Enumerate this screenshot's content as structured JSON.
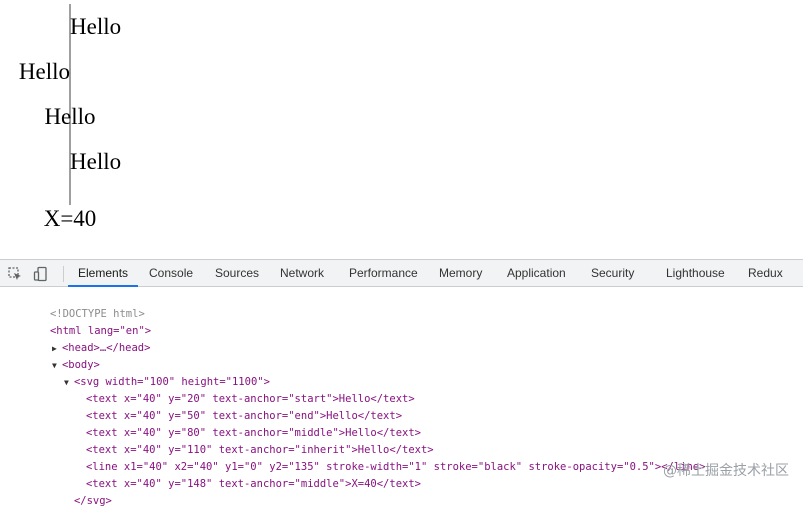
{
  "rendered": {
    "texts": [
      "Hello",
      "Hello",
      "Hello",
      "Hello",
      "X=40"
    ]
  },
  "devtools": {
    "tabs": [
      "Elements",
      "Console",
      "Sources",
      "Network",
      "Performance",
      "Memory",
      "Application",
      "Security",
      "Lighthouse",
      "Redux"
    ],
    "active_tab": "Elements",
    "dom_lines": [
      "<!DOCTYPE html>",
      "<html lang=\"en\">",
      "<head>…</head>",
      "<body>",
      "<svg width=\"100\" height=\"1100\">",
      "<text x=\"40\" y=\"20\" text-anchor=\"start\">Hello</text>",
      "<text x=\"40\" y=\"50\" text-anchor=\"end\">Hello</text>",
      "<text x=\"40\" y=\"80\" text-anchor=\"middle\">Hello</text>",
      "<text x=\"40\" y=\"110\" text-anchor=\"inherit\">Hello</text>",
      "<line x1=\"40\" x2=\"40\" y1=\"0\" y2=\"135\" stroke-width=\"1\" stroke=\"black\" stroke-opacity=\"0.5\"></line>",
      "<text x=\"40\" y=\"148\" text-anchor=\"middle\">X=40</text>",
      "</svg>"
    ]
  },
  "watermark": "@稀土掘金技术社区"
}
